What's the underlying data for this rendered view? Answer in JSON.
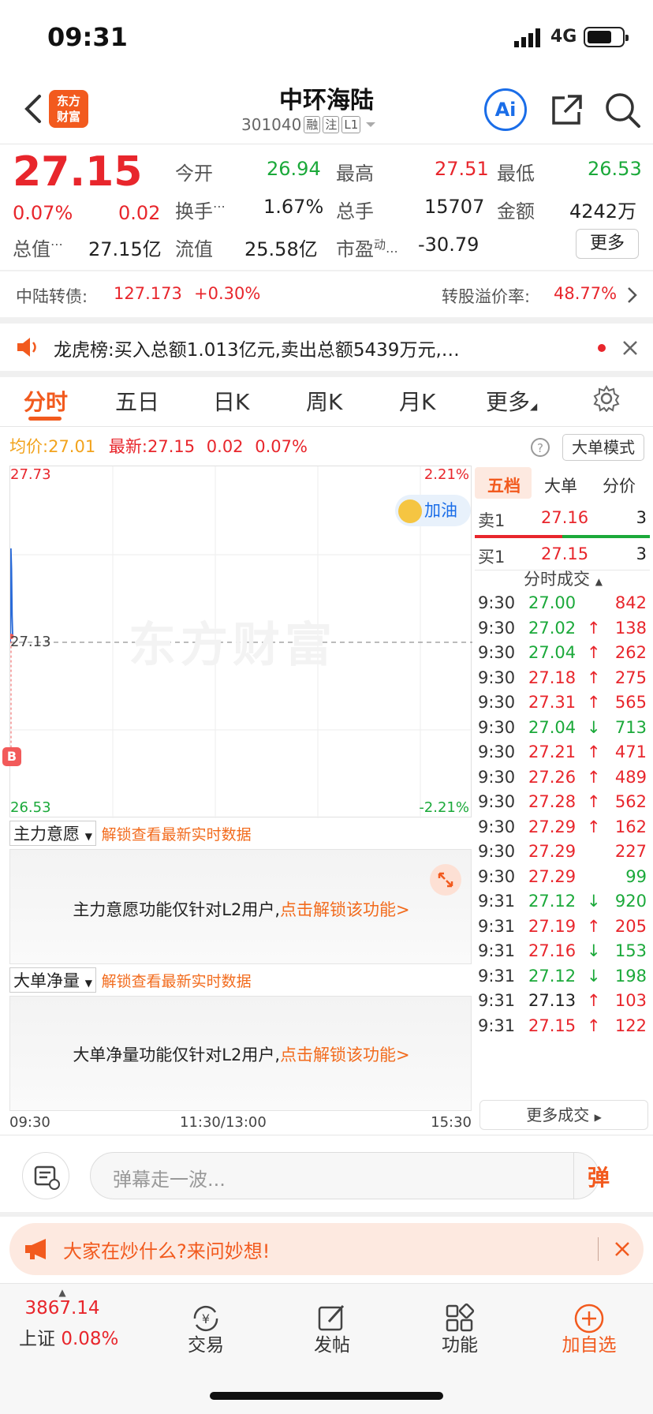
{
  "status": {
    "time": "09:31",
    "network": "4G"
  },
  "header": {
    "logo_line1": "东方",
    "logo_line2": "财富",
    "name": "中环海陆",
    "code": "301040",
    "tags": [
      "融",
      "注",
      "L1"
    ],
    "ai": "Ai"
  },
  "quote": {
    "price": "27.15",
    "pct": "0.07%",
    "change": "0.02",
    "open_label": "今开",
    "open": "26.94",
    "high_label": "最高",
    "high": "27.51",
    "low_label": "最低",
    "low": "26.53",
    "turnover_label": "换手",
    "turnover": "1.67%",
    "volume_label": "总手",
    "volume": "15707",
    "amount_label": "金额",
    "amount": "4242万",
    "mktcap_label": "总值",
    "mktcap": "27.15亿",
    "float_label": "流值",
    "float": "25.58亿",
    "pe_label": "市盈",
    "pe_sup": "动",
    "pe": "-30.79",
    "more": "更多"
  },
  "bond": {
    "label": "中陆转债:",
    "price": "127.173",
    "pct": "+0.30%",
    "premium_label": "转股溢价率:",
    "premium": "48.77%"
  },
  "lhb": {
    "text": "龙虎榜:买入总额1.013亿元,卖出总额5439万元,…"
  },
  "tabs": [
    "分时",
    "五日",
    "日K",
    "周K",
    "月K",
    "更多"
  ],
  "avg": {
    "avg_label": "均价:",
    "avg": "27.01",
    "last_label": "最新:",
    "last": "27.15",
    "chg": "0.02",
    "pct": "0.07%",
    "mode_btn": "大单模式"
  },
  "chart": {
    "y_high": "27.73",
    "y_mid": "27.13",
    "y_low": "26.53",
    "pct_high": "2.21%",
    "pct_low": "-2.21%",
    "watermark": "东方财富",
    "badge": "加油",
    "b_marker": "B"
  },
  "chart_data": {
    "type": "line",
    "series": [
      {
        "values": [
          27.13,
          27.45,
          27.38,
          27.22,
          27.15
        ]
      }
    ],
    "ylim": [
      26.53,
      27.73
    ],
    "x_ticks": [
      "09:30",
      "11:30/13:00",
      "15:30"
    ]
  },
  "rpanel": {
    "tabs": [
      "五档",
      "大单",
      "分价"
    ],
    "sell1": {
      "label": "卖1",
      "price": "27.16",
      "vol": "3"
    },
    "buy1": {
      "label": "买1",
      "price": "27.15",
      "vol": "3"
    },
    "ticks_title": "分时成交",
    "ticks": [
      {
        "t": "9:30",
        "p": "27.00",
        "a": "",
        "v": "842",
        "pc": "green",
        "vc": "red"
      },
      {
        "t": "9:30",
        "p": "27.02",
        "a": "↑",
        "v": "138",
        "pc": "green",
        "vc": "red"
      },
      {
        "t": "9:30",
        "p": "27.04",
        "a": "↑",
        "v": "262",
        "pc": "green",
        "vc": "red"
      },
      {
        "t": "9:30",
        "p": "27.18",
        "a": "↑",
        "v": "275",
        "pc": "red",
        "vc": "red"
      },
      {
        "t": "9:30",
        "p": "27.31",
        "a": "↑",
        "v": "565",
        "pc": "red",
        "vc": "red"
      },
      {
        "t": "9:30",
        "p": "27.04",
        "a": "↓",
        "v": "713",
        "pc": "green",
        "vc": "green"
      },
      {
        "t": "9:30",
        "p": "27.21",
        "a": "↑",
        "v": "471",
        "pc": "red",
        "vc": "red"
      },
      {
        "t": "9:30",
        "p": "27.26",
        "a": "↑",
        "v": "489",
        "pc": "red",
        "vc": "red"
      },
      {
        "t": "9:30",
        "p": "27.28",
        "a": "↑",
        "v": "562",
        "pc": "red",
        "vc": "red"
      },
      {
        "t": "9:30",
        "p": "27.29",
        "a": "↑",
        "v": "162",
        "pc": "red",
        "vc": "red"
      },
      {
        "t": "9:30",
        "p": "27.29",
        "a": "",
        "v": "227",
        "pc": "red",
        "vc": "red"
      },
      {
        "t": "9:30",
        "p": "27.29",
        "a": "",
        "v": "99",
        "pc": "red",
        "vc": "green"
      },
      {
        "t": "9:31",
        "p": "27.12",
        "a": "↓",
        "v": "920",
        "pc": "green",
        "vc": "green"
      },
      {
        "t": "9:31",
        "p": "27.19",
        "a": "↑",
        "v": "205",
        "pc": "red",
        "vc": "red"
      },
      {
        "t": "9:31",
        "p": "27.16",
        "a": "↓",
        "v": "153",
        "pc": "red",
        "vc": "green"
      },
      {
        "t": "9:31",
        "p": "27.12",
        "a": "↓",
        "v": "198",
        "pc": "green",
        "vc": "green"
      },
      {
        "t": "9:31",
        "p": "27.13",
        "a": "↑",
        "v": "103",
        "pc": "black",
        "vc": "red"
      },
      {
        "t": "9:31",
        "p": "27.15",
        "a": "↑",
        "v": "122",
        "pc": "red",
        "vc": "red"
      }
    ],
    "more_ticks": "更多成交"
  },
  "l2": {
    "main_title": "主力意愿",
    "unlock": "解锁查看最新实时数据",
    "main_msg": "主力意愿功能仅针对L2用户,",
    "unlock_link": "点击解锁该功能>",
    "big_title": "大单净量",
    "big_msg": "大单净量功能仅针对L2用户,"
  },
  "danmu": {
    "placeholder": "弹幕走一波...",
    "btn": "弹"
  },
  "ask": {
    "text": "大家在炒什么?来问妙想!"
  },
  "nav": {
    "index_value": "3867.14",
    "index_name": "上证",
    "index_pct": "0.08%",
    "trade": "交易",
    "post": "发帖",
    "func": "功能",
    "add": "加自选"
  }
}
